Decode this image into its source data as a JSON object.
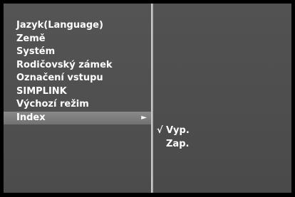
{
  "menu": {
    "items": [
      {
        "label": "Jazyk(Language)"
      },
      {
        "label": "Země"
      },
      {
        "label": "Systém"
      },
      {
        "label": "Rodičovský zámek"
      },
      {
        "label": "Označení vstupu"
      },
      {
        "label": "SIMPLINK"
      },
      {
        "label": "Výchozí režim"
      },
      {
        "label": "Index",
        "arrow": "►"
      }
    ],
    "selected": "Index"
  },
  "submenu": {
    "options": [
      {
        "label": "Vyp.",
        "checkmark": "√"
      },
      {
        "label": "Zap."
      }
    ],
    "selected": "Vyp."
  },
  "colors": {
    "panel": "#505050",
    "highlight": "#808080",
    "divider": "#c8c8c8",
    "text": "#ffffff",
    "background": "#000000"
  }
}
